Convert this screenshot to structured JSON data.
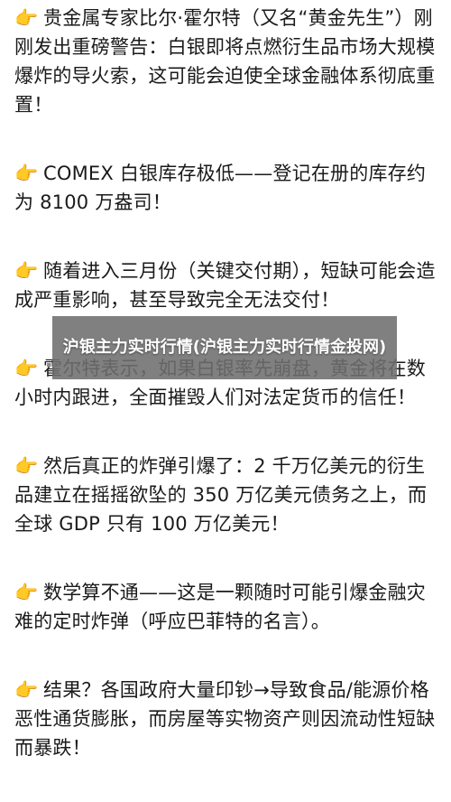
{
  "article": {
    "paragraphs": [
      {
        "icon": "pointing-hand-icon",
        "text": "贵金属专家比尔·霍尔特（又名“黄金先生”）刚刚发出重磅警告：白银即将点燃衍生品市场大规模爆炸的导火索，这可能会迫使全球金融体系彻底重置！"
      },
      {
        "icon": "pointing-hand-icon",
        "text": "COMEX 白银库存极低——登记在册的库存约为 8100 万盎司！"
      },
      {
        "icon": "pointing-hand-icon",
        "text": "随着进入三月份（关键交付期），短缺可能会造成严重影响，甚至导致完全无法交付！"
      },
      {
        "icon": "pointing-hand-icon",
        "text": "霍尔特表示，如果白银率先崩盘，黄金将在数小时内跟进，全面摧毁人们对法定货币的信任！"
      },
      {
        "icon": "pointing-hand-icon",
        "text": "然后真正的炸弹引爆了：2 千万亿美元的衍生品建立在摇摇欲坠的 350 万亿美元债务之上，而全球 GDP 只有 100 万亿美元！"
      },
      {
        "icon": "pointing-hand-icon",
        "text": "数学算不通——这是一颗随时可能引爆金融灾难的定时炸弹（呼应巴菲特的名言）。"
      },
      {
        "icon": "pointing-hand-icon",
        "text": "结果？各国政府大量印钞→导致食品/能源价格恶性通货膨胀，而房屋等实物资产则因流动性短缺而暴跌！"
      }
    ]
  },
  "overlay": {
    "title": "沪银主力实时行情(沪银主力实时行情金投网)"
  },
  "colors": {
    "text": "#1a1a1a",
    "background": "#ffffff",
    "overlay": "#6e6e6e",
    "icon": "#f5b82e"
  }
}
